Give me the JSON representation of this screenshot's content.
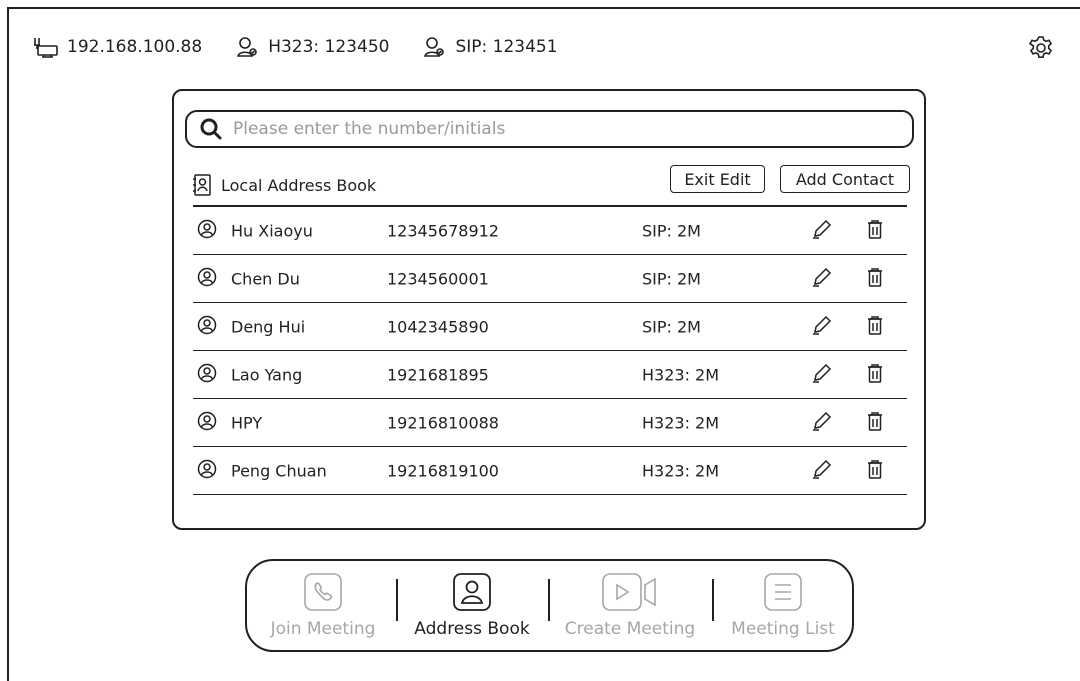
{
  "status": {
    "ip": "192.168.100.88",
    "h323": "H323: 123450",
    "sip": "SIP: 123451"
  },
  "search": {
    "placeholder": "Please enter the number/initials"
  },
  "book": {
    "title": "Local Address Book",
    "exit_edit_label": "Exit Edit",
    "add_contact_label": "Add Contact"
  },
  "contacts": [
    {
      "name": "Hu Xiaoyu",
      "number": "12345678912",
      "protocol": "SIP: 2M"
    },
    {
      "name": "Chen Du",
      "number": "1234560001",
      "protocol": "SIP: 2M"
    },
    {
      "name": "Deng Hui",
      "number": "1042345890",
      "protocol": "SIP: 2M"
    },
    {
      "name": "Lao Yang",
      "number": "1921681895",
      "protocol": "H323: 2M"
    },
    {
      "name": "HPY",
      "number": "19216810088",
      "protocol": "H323: 2M"
    },
    {
      "name": "Peng Chuan",
      "number": "19216819100",
      "protocol": "H323: 2M"
    }
  ],
  "nav": {
    "join": "Join Meeting",
    "address": "Address Book",
    "create": "Create Meeting",
    "list": "Meeting List"
  },
  "colors": {
    "line": "#231f20",
    "inactive": "#a7a7a7"
  }
}
